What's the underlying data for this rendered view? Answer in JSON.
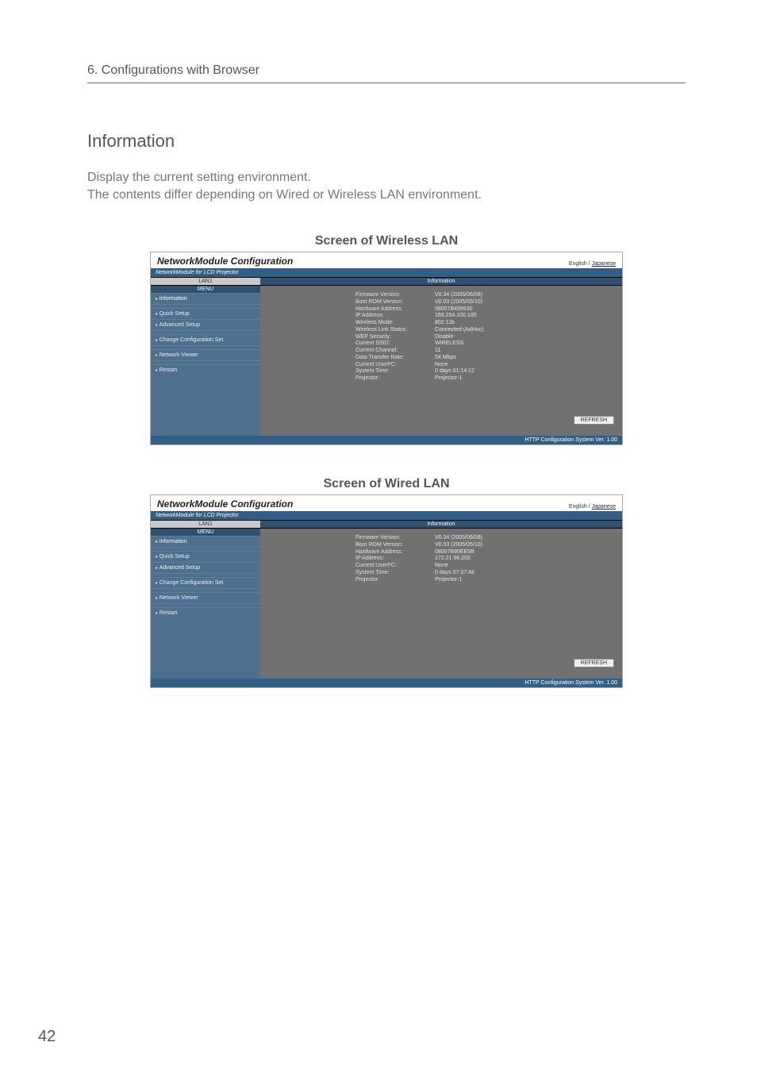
{
  "page": {
    "breadcrumb": "6. Configurations with Browser",
    "heading": "Information",
    "body1": "Display the current setting environment.",
    "body2": "The contents differ depending on Wired or Wireless LAN environment.",
    "caption_wireless": "Screen of Wireless LAN",
    "caption_wired": "Screen of Wired LAN",
    "page_number": "42"
  },
  "shot_common": {
    "title": "NetworkModule Configuration",
    "lang_en": "English",
    "lang_sep": " / ",
    "lang_jp": "Japanese",
    "subhead": "NetworkModule for LCD Projector",
    "info_header": "Information",
    "refresh": "REFRESH",
    "footer": "HTTP Configuration System Ver. 1.00",
    "lan_label_lan1": "LAN1",
    "menu_header": "MENU"
  },
  "sidebar_items": [
    "Information",
    "Quick Setup",
    "Advanced Setup",
    "Change Configuration Set",
    "Network Viewer",
    "Restart"
  ],
  "wireless_rows": [
    [
      "Firmware Version:",
      "V0.34 (2005/06/08)"
    ],
    [
      "Boot ROM Version:",
      "V0.03 (2005/05/10)"
    ],
    [
      "Hardware Address:",
      "08007B459930"
    ],
    [
      "IP Address:",
      "169.254.100.100"
    ],
    [
      "Wireless Mode:",
      "802.11b"
    ],
    [
      "Wireless Link Status:",
      "Connected (AdHoc)"
    ],
    [
      "WEP Security:",
      "Disable"
    ],
    [
      "Current SSID:",
      "WIRELESS"
    ],
    [
      "Current Channel:",
      "11"
    ],
    [
      "Data Transfer Rate:",
      "54 Mbps"
    ],
    [
      "Current UserPC:",
      "None"
    ],
    [
      "System Time:",
      "0 days 01:14:12"
    ],
    [
      "Projector:",
      "Projector-1"
    ]
  ],
  "wired_rows": [
    [
      "Firmware Version:",
      "V0.34 (2005/06/08)"
    ],
    [
      "Boot ROM Version:",
      "V0.03 (2005/05/10)"
    ],
    [
      "Hardware Address:",
      "08007B95EE5B"
    ],
    [
      "IP Address:",
      "172.21.96.202"
    ],
    [
      "Current UserPC:",
      "None"
    ],
    [
      "System Time:",
      "0 days 07:37:48"
    ],
    [
      "Projector:",
      "Projector-1"
    ]
  ]
}
